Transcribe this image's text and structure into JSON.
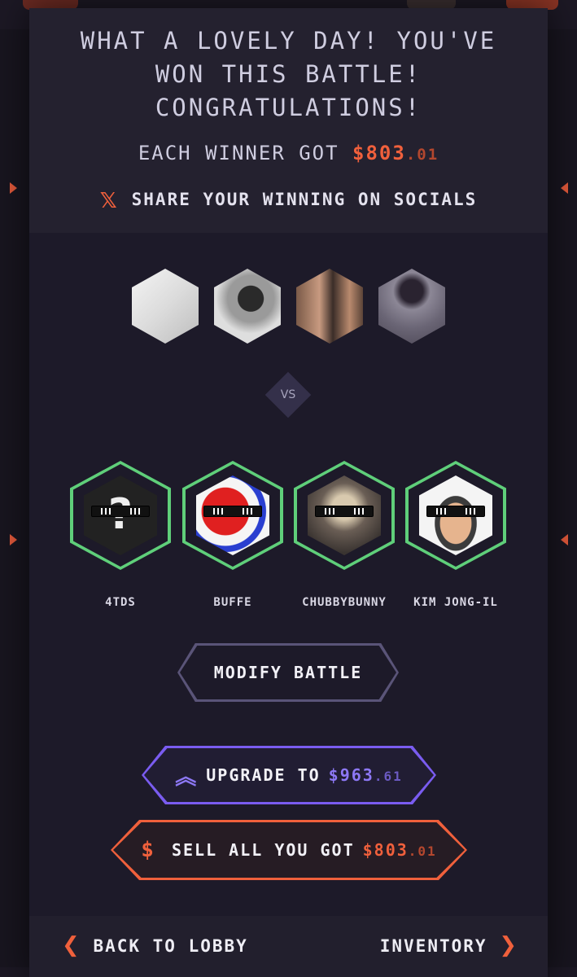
{
  "result": {
    "title": "WHAT A LOVELY DAY! YOU'VE\nWON THIS BATTLE!\nCONGRATULATIONS!",
    "prize_prefix": "EACH WINNER GOT",
    "prize_amount": "$803",
    "prize_cents": ".01",
    "share_label": "SHARE YOUR WINNING ON SOCIALS"
  },
  "vs_label": "VS",
  "winners": [
    {
      "name": "4TDS"
    },
    {
      "name": "BUFFE"
    },
    {
      "name": "CHUBBYBUNNY"
    },
    {
      "name": "KIM JONG-IL"
    }
  ],
  "buttons": {
    "modify": "MODIFY BATTLE",
    "upgrade_label": "UPGRADE TO",
    "upgrade_amount": "$963",
    "upgrade_cents": ".61",
    "sell_label": "SELL ALL YOU GOT",
    "sell_amount": "$803",
    "sell_cents": ".01"
  },
  "footer": {
    "back": "BACK TO LOBBY",
    "inventory": "INVENTORY"
  },
  "colors": {
    "accent": "#f0603c",
    "winner_border": "#5fcf7a",
    "upgrade": "#7a5cf0"
  }
}
